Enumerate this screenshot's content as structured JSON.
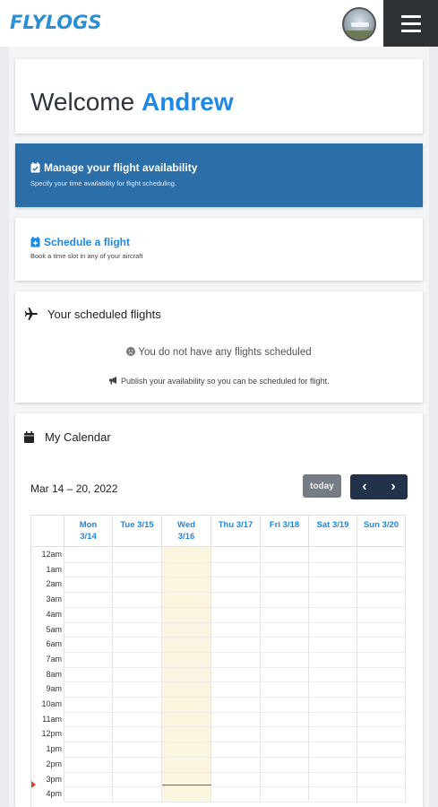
{
  "header": {
    "logo": "FLYLOGS",
    "avatar": "user-avatar",
    "menu_icon": "hamburger-menu-icon"
  },
  "welcome": {
    "greeting": "Welcome",
    "name": "Andrew"
  },
  "availability_card": {
    "icon": "calendar-check-icon",
    "title": "Manage your flight availability",
    "subtitle": "Specify your time availability for flight scheduling.",
    "background": "#2c6ea8"
  },
  "schedule_card": {
    "icon": "calendar-plus-icon",
    "title": "Schedule a flight",
    "subtitle": "Book a time slot in any of your aircraft",
    "accent": "#1e88e5"
  },
  "scheduled_flights": {
    "icon": "plane-icon",
    "title": "Your scheduled flights",
    "empty_icon": "frown-icon",
    "empty_text": "You do not have any flights scheduled",
    "hint_icon": "megaphone-icon",
    "hint_text": "Publish your availability so you can be scheduled for flight."
  },
  "calendar": {
    "icon": "calendar-icon",
    "title": "My Calendar",
    "range": "Mar 14 – 20, 2022",
    "today_label": "today",
    "prev_label": "‹",
    "next_label": "›",
    "days": [
      {
        "line1": "Mon",
        "line2": "3/14"
      },
      {
        "line1": "Tue 3/15",
        "line2": ""
      },
      {
        "line1": "Wed",
        "line2": "3/16"
      },
      {
        "line1": "Thu 3/17",
        "line2": ""
      },
      {
        "line1": "Fri 3/18",
        "line2": ""
      },
      {
        "line1": "Sat 3/19",
        "line2": ""
      },
      {
        "line1": "Sun 3/20",
        "line2": ""
      }
    ],
    "highlighted_day": "Wed 3/16",
    "times": [
      "12am",
      "1am",
      "2am",
      "3am",
      "4am",
      "5am",
      "6am",
      "7am",
      "8am",
      "9am",
      "10am",
      "11am",
      "12pm",
      "1pm",
      "2pm",
      "3pm",
      "4pm"
    ],
    "today_color": "#fcf6e0",
    "now_indicator_color": "#e53935"
  }
}
